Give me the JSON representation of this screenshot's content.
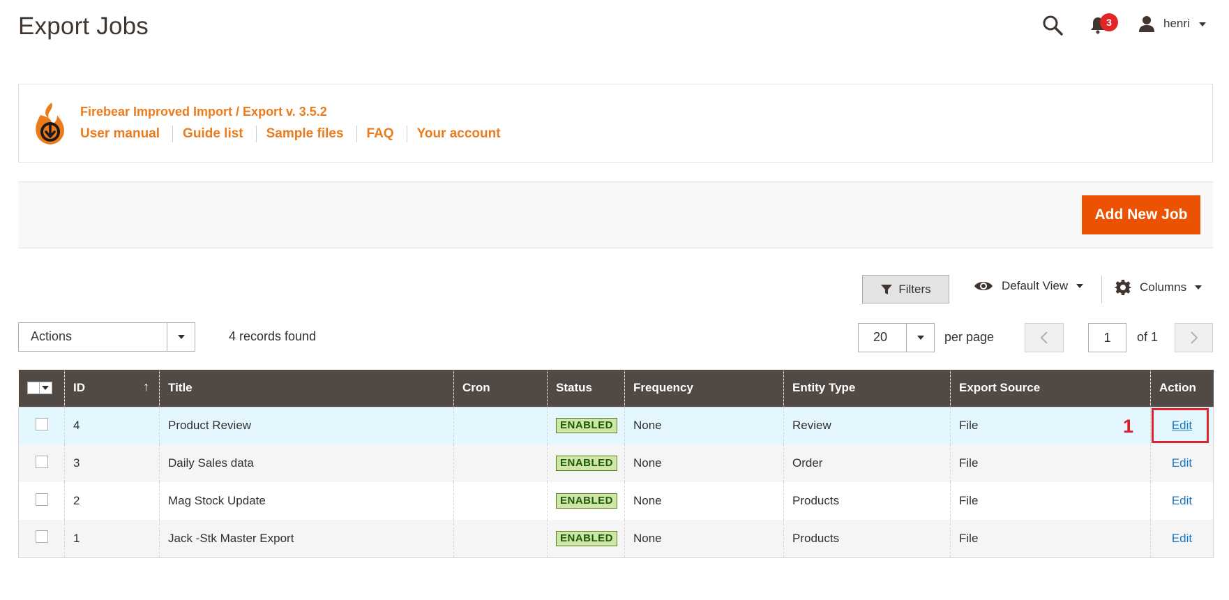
{
  "header": {
    "title": "Export Jobs",
    "notification_count": "3",
    "user_name": "henri"
  },
  "firebear": {
    "title": "Firebear Improved Import / Export v. 3.5.2",
    "links": [
      "User manual",
      "Guide list",
      "Sample files",
      "FAQ",
      "Your account"
    ]
  },
  "action_bar": {
    "add_button": "Add New Job"
  },
  "toolbar": {
    "filters": "Filters",
    "default_view": "Default View",
    "columns": "Columns",
    "actions": "Actions",
    "records_found": "4 records found",
    "per_page_value": "20",
    "per_page_label": "per page",
    "page_value": "1",
    "of_label": "of 1"
  },
  "grid": {
    "headers": [
      "ID",
      "Title",
      "Cron",
      "Status",
      "Frequency",
      "Entity Type",
      "Export Source",
      "Action"
    ],
    "rows": [
      {
        "id": "4",
        "title": "Product Review",
        "cron": "",
        "status": "ENABLED",
        "frequency": "None",
        "entity": "Review",
        "source": "File",
        "action": "Edit"
      },
      {
        "id": "3",
        "title": "Daily Sales data",
        "cron": "",
        "status": "ENABLED",
        "frequency": "None",
        "entity": "Order",
        "source": "File",
        "action": "Edit"
      },
      {
        "id": "2",
        "title": "Mag Stock Update",
        "cron": "",
        "status": "ENABLED",
        "frequency": "None",
        "entity": "Products",
        "source": "File",
        "action": "Edit"
      },
      {
        "id": "1",
        "title": "Jack -Stk Master Export",
        "cron": "",
        "status": "ENABLED",
        "frequency": "None",
        "entity": "Products",
        "source": "File",
        "action": "Edit"
      }
    ]
  },
  "annotation": {
    "number": "1",
    "color": "#e0222d"
  },
  "colors": {
    "accent_orange": "#eb5202",
    "firebear_orange": "#eb7b1d",
    "grid_header": "#514943",
    "link_blue": "#1979c3"
  }
}
